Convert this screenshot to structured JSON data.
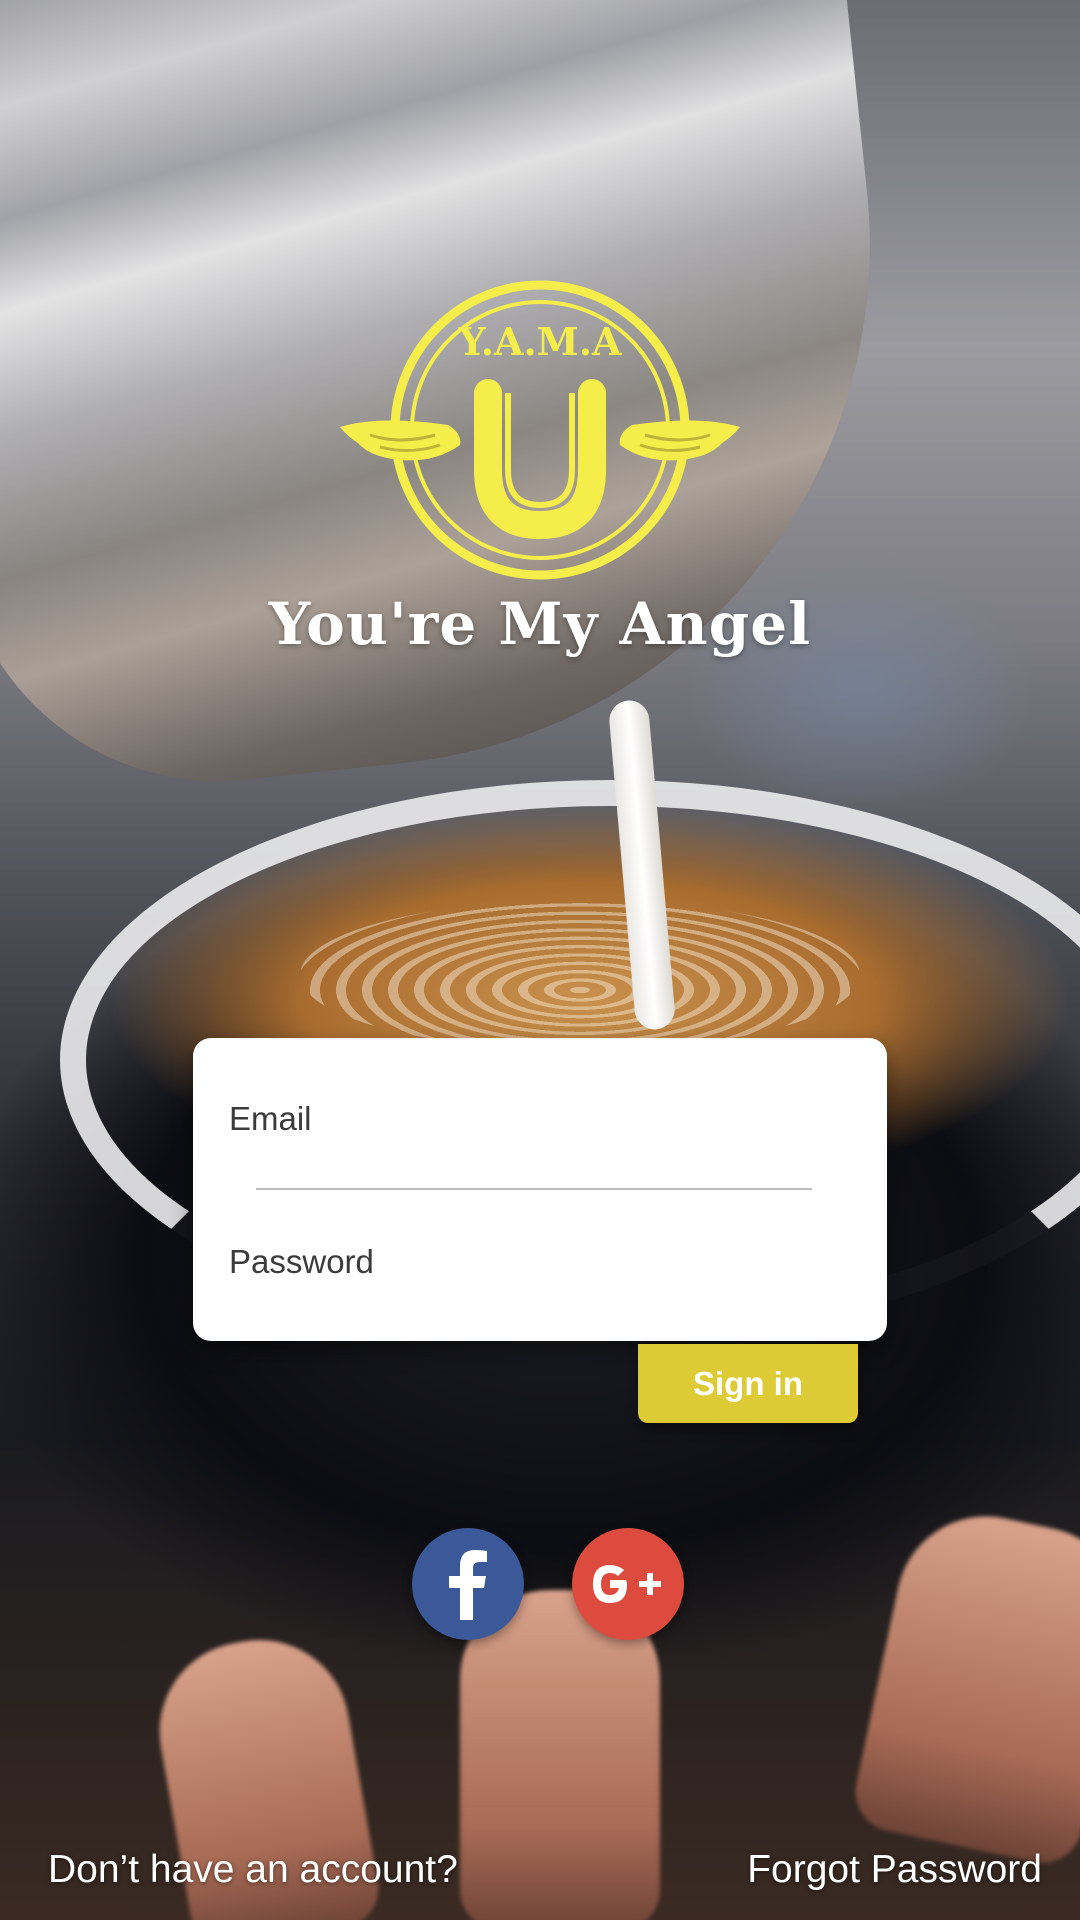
{
  "brand": {
    "logo_text": "Y.A.M.A",
    "name": "You're My Angel",
    "logo_color": "#f5ee4a"
  },
  "login_form": {
    "email_label": "Email",
    "password_label": "Password"
  },
  "actions": {
    "sign_in_label": "Sign in",
    "sign_in_color": "#dccb34"
  },
  "social_login": [
    {
      "icon": "facebook-icon",
      "color": "#3b5999"
    },
    {
      "icon": "google-plus-icon",
      "color": "#dd4b3e"
    }
  ],
  "footer": {
    "signup_prompt": "Don’t have an account?",
    "forgot_password": "Forgot Password"
  }
}
